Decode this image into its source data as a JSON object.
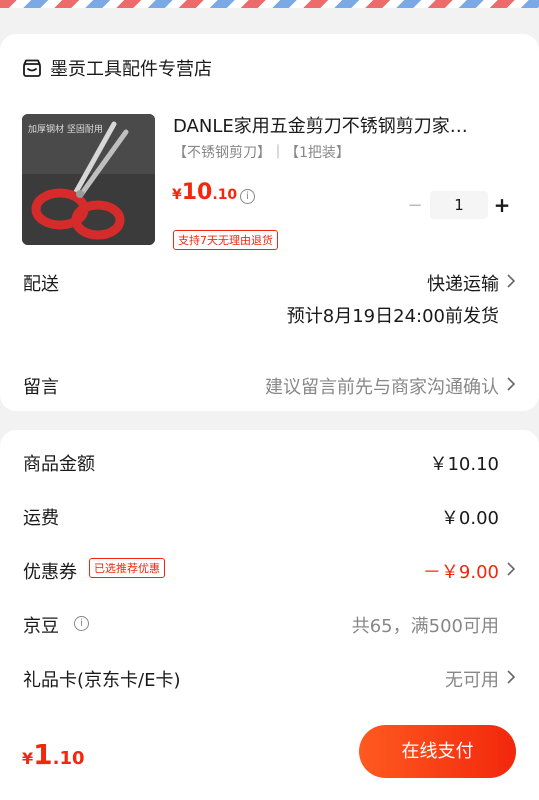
{
  "shop": {
    "name": "墨贡工具配件专营店"
  },
  "product": {
    "title": "DANLE家用五金剪刀不锈钢剪刀家…",
    "spec": "【不锈钢剪刀】｜【1把装】",
    "price_currency": "¥",
    "price_integer": "10",
    "price_decimal": ".10",
    "quantity": "1",
    "badge": "支持7天无理由退货",
    "image_text": "加厚钢材  坚固耐用"
  },
  "delivery": {
    "label": "配送",
    "method": "快递运输",
    "eta": "预计8月19日24:00前发货"
  },
  "message": {
    "label": "留言",
    "placeholder": "建议留言前先与商家沟通确认"
  },
  "fees": {
    "goods_label": "商品金额",
    "goods_value": "￥10.10",
    "shipping_label": "运费",
    "shipping_value": "￥0.00",
    "coupon_label": "优惠券",
    "coupon_badge": "已选推荐优惠",
    "coupon_value": "－￥9.00",
    "jd_label": "京豆",
    "jd_value": "共65，满500可用",
    "giftcard_label": "礼品卡(京东卡/E卡)",
    "giftcard_value": "无可用"
  },
  "footer": {
    "total_currency": "¥",
    "total_integer": "1",
    "total_decimal": ".10",
    "pay_label": "在线支付"
  },
  "colors": {
    "accent": "#f2270c",
    "muted": "#888888"
  },
  "icons": [
    "shop-icon",
    "info-icon",
    "chevron-right-icon",
    "minus-icon",
    "plus-icon"
  ]
}
